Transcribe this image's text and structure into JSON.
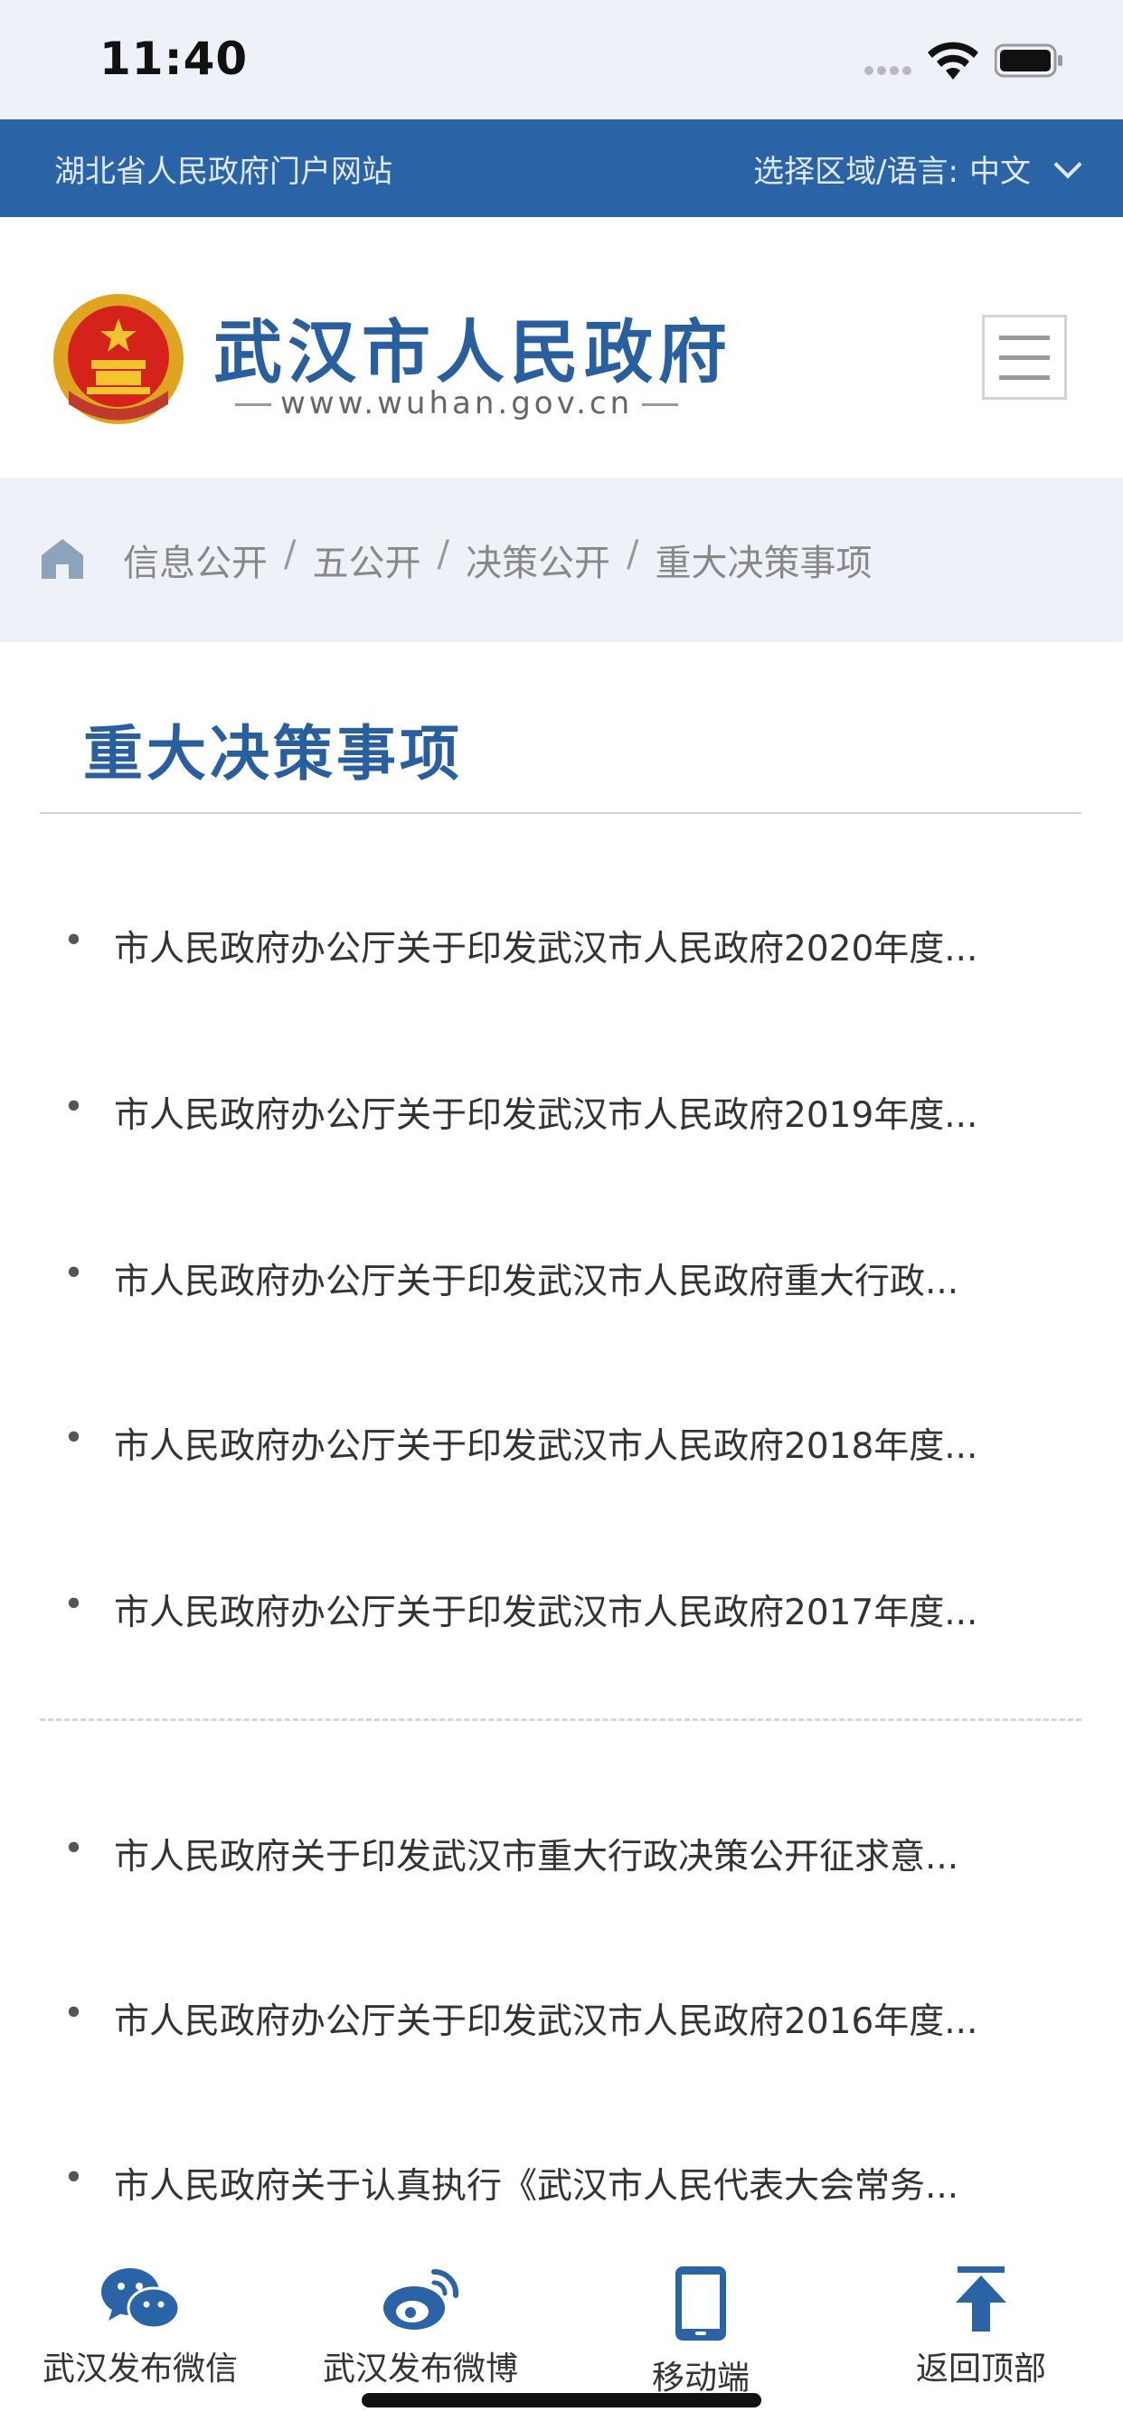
{
  "status": {
    "time": "11:40"
  },
  "topbar": {
    "portal": "湖北省人民政府门户网站",
    "region_label": "选择区域/语言:",
    "language": "中文"
  },
  "header": {
    "title": "武汉市人民政府",
    "url": "www.wuhan.gov.cn"
  },
  "breadcrumb": {
    "items": [
      "信息公开",
      "五公开",
      "决策公开",
      "重大决策事项"
    ],
    "separator": "/"
  },
  "section": {
    "title": "重大决策事项"
  },
  "list": {
    "items": [
      "市人民政府办公厅关于印发武汉市人民政府2020年度...",
      "市人民政府办公厅关于印发武汉市人民政府2019年度...",
      "市人民政府办公厅关于印发武汉市人民政府重大行政...",
      "市人民政府办公厅关于印发武汉市人民政府2018年度...",
      "市人民政府办公厅关于印发武汉市人民政府2017年度...",
      "市人民政府关于印发武汉市重大行政决策公开征求意...",
      "市人民政府办公厅关于印发武汉市人民政府2016年度...",
      "市人民政府关于认真执行《武汉市人民代表大会常务..."
    ]
  },
  "bottom_nav": {
    "items": [
      {
        "label": "武汉发布微信",
        "icon": "wechat-icon"
      },
      {
        "label": "武汉发布微博",
        "icon": "weibo-icon"
      },
      {
        "label": "移动端",
        "icon": "mobile-icon"
      },
      {
        "label": "返回顶部",
        "icon": "back-to-top-icon"
      }
    ]
  },
  "colors": {
    "brand_blue": "#2b64a6",
    "title_blue": "#2a5f9f",
    "breadcrumb_bg": "#eef2f8"
  }
}
